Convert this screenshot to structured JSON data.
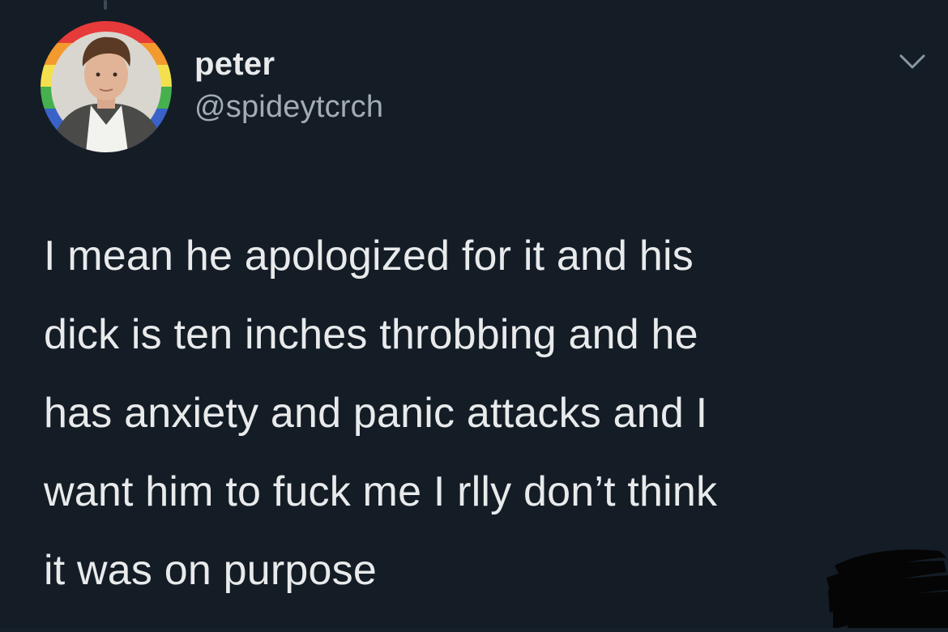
{
  "tweet": {
    "display_name": "peter",
    "handle": "@spideytcrch",
    "text": "I mean he apologized for it and his\ndick is ten inches throbbing and he\nhas anxiety and panic attacks and I\nwant him to fuck me I rlly don’t think\nit was on purpose"
  },
  "icons": {
    "menu": "chevron-down-icon",
    "avatar": "profile-photo-rainbow-border",
    "redaction": "black-scribble"
  },
  "colors": {
    "background": "#141d26",
    "primary_text": "#e8eaeb",
    "secondary_text": "#a3acb5"
  }
}
